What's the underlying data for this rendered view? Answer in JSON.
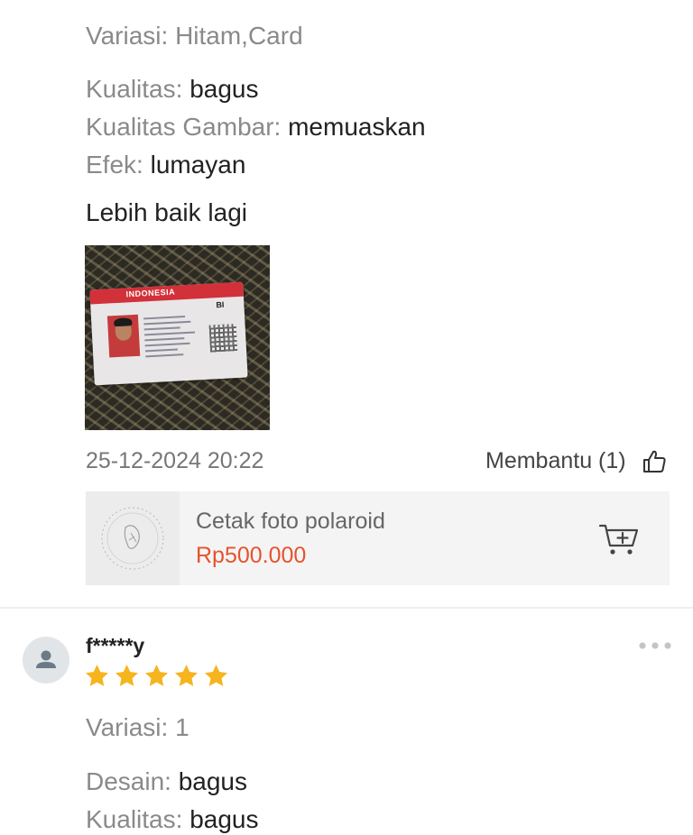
{
  "review_1": {
    "variation": "Variasi: Hitam,Card",
    "attributes": [
      {
        "label": "Kualitas:",
        "value": "bagus"
      },
      {
        "label": "Kualitas Gambar:",
        "value": "memuaskan"
      },
      {
        "label": "Efek:",
        "value": "lumayan"
      }
    ],
    "comment": "Lebih baik lagi",
    "photo_card": {
      "header": "INDONESIA",
      "code": "BI"
    },
    "date": "25-12-2024 20:22",
    "helpful_label": "Membantu (1)",
    "product": {
      "name": "Cetak foto polaroid",
      "price": "Rp500.000"
    }
  },
  "review_2": {
    "username": "f*****y",
    "rating": 5,
    "variation": "Variasi: 1",
    "attributes": [
      {
        "label": "Desain:",
        "value": "bagus"
      },
      {
        "label": "Kualitas:",
        "value": "bagus"
      }
    ]
  },
  "colors": {
    "price": "#e5532d",
    "star": "#f6b41e",
    "muted_text": "#8a8a8a"
  },
  "icons": [
    "thumbs-up-icon",
    "add-to-cart-icon",
    "user-icon",
    "more-options-icon",
    "star-icon"
  ]
}
